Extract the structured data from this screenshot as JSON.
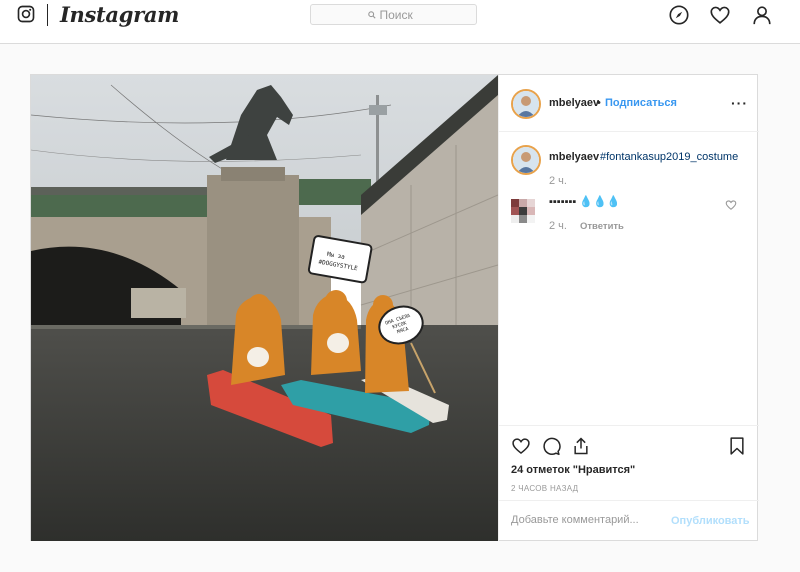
{
  "nav": {
    "logo_icon": "instagram-camera-icon",
    "wordmark": "Instagram",
    "search_placeholder": "Поиск",
    "icons": [
      "explore-compass-icon",
      "heart-icon",
      "profile-icon"
    ]
  },
  "post": {
    "author": "mbelyaev",
    "follow_label": "Подписаться",
    "more_icon": "more-options-icon",
    "caption": {
      "user": "mbelyaev",
      "hashtag": "#fontankasup2019_costume",
      "time": "2 ч."
    },
    "comment": {
      "text": "▪▪▪▪▪▪▪ 💧💧💧",
      "time": "2 ч.",
      "reply_label": "Ответить"
    },
    "photo_signs": {
      "sign_left": "Мы за #DOGGYSTYLE",
      "sign_right": "ОНА СЪЕЛА КУСОК МЯСА"
    },
    "likes": "24 отметок \"Нравится\"",
    "posted_ago": "2 ЧАСОВ НАЗАД",
    "comment_placeholder": "Добавьте комментарий...",
    "publish_label": "Опубликовать"
  },
  "colors": {
    "link": "#3897f0",
    "hashtag": "#003569",
    "publish_disabled": "#b2dffc",
    "border": "#dbdbdb"
  }
}
